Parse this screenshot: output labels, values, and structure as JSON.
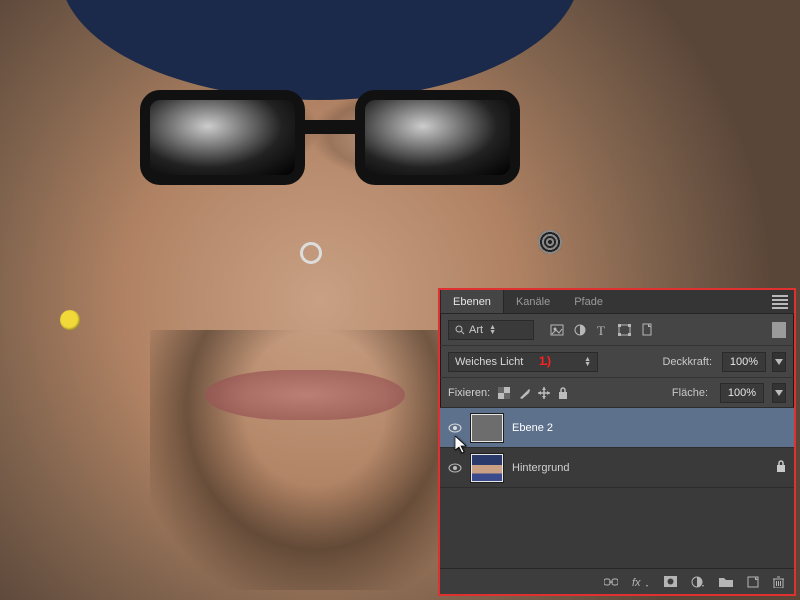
{
  "panel": {
    "tabs": {
      "active": "Ebenen",
      "t1": "Kanäle",
      "t2": "Pfade"
    },
    "search_label": "Art",
    "blend_mode": "Weiches Licht",
    "annotation_marker": "1.)",
    "opacity_label": "Deckkraft:",
    "opacity_value": "100%",
    "lock_label": "Fixieren:",
    "fill_label": "Fläche:",
    "fill_value": "100%",
    "layers": [
      {
        "name": "Ebene 2",
        "selected": true,
        "locked": false
      },
      {
        "name": "Hintergrund",
        "selected": false,
        "locked": true
      }
    ]
  }
}
